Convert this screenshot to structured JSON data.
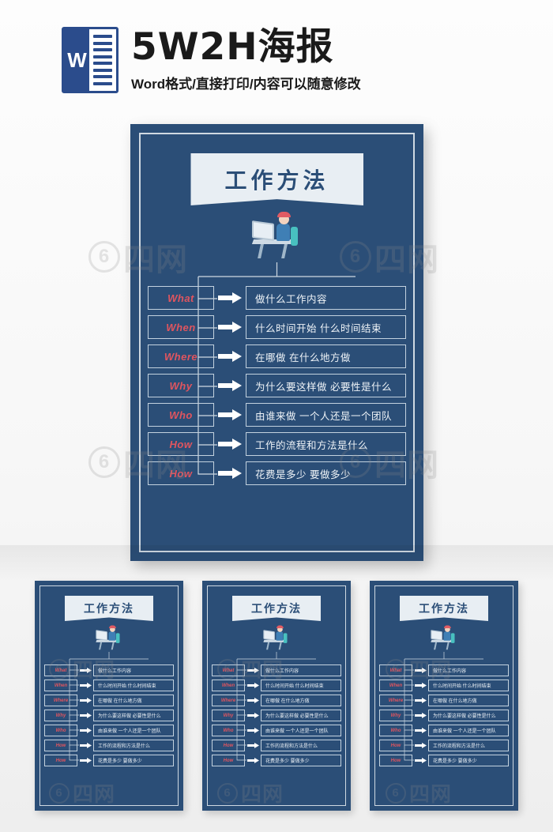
{
  "header": {
    "logo_letter": "W",
    "logo_name": "word-document-icon",
    "title": "5W2H海报",
    "subtitle": "Word格式/直接打印/内容可以随意修改"
  },
  "poster": {
    "banner_title": "工作方法",
    "illustration_name": "person-at-desk-illustration",
    "rows": [
      {
        "key": "What",
        "value": "做什么工作内容"
      },
      {
        "key": "When",
        "value": "什么时间开始 什么时间结束"
      },
      {
        "key": "Where",
        "value": "在哪做 在什么地方做"
      },
      {
        "key": "Why",
        "value": "为什么要这样做 必要性是什么"
      },
      {
        "key": "Who",
        "value": "由谁来做 一个人还是一个团队"
      },
      {
        "key": "How",
        "value": "工作的流程和方法是什么"
      },
      {
        "key": "How",
        "value": "花费是多少 要做多少"
      }
    ]
  },
  "thumbnails": [
    {
      "label": "thumbnail-1"
    },
    {
      "label": "thumbnail-2"
    },
    {
      "label": "thumbnail-3"
    }
  ],
  "watermark": {
    "text": "四网",
    "mark": "6"
  },
  "colors": {
    "poster_bg": "#2b4e77",
    "banner_bg": "#e8eef3",
    "key_text": "#e0555f",
    "border": "#c3d2df",
    "logo_blue": "#2b4c8c"
  }
}
